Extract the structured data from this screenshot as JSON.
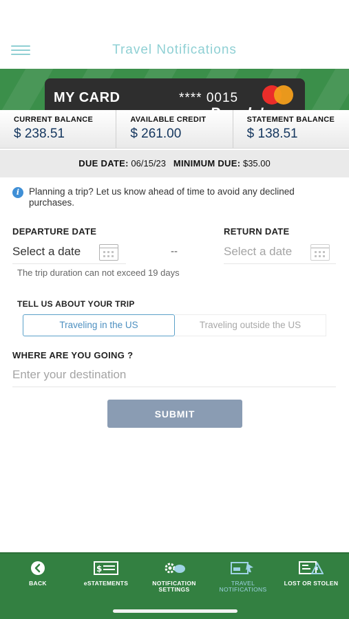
{
  "header": {
    "title": "Travel Notifications",
    "menu_icon": "hamburger-menu-icon"
  },
  "card": {
    "name": "MY CARD",
    "number": "**** 0015",
    "brand_text": "People's",
    "network": "mastercard-logo"
  },
  "balances": [
    {
      "label": "CURRENT BALANCE",
      "value": "$ 238.51"
    },
    {
      "label": "AVAILABLE CREDIT",
      "value": "$ 261.00"
    },
    {
      "label": "STATEMENT BALANCE",
      "value": "$ 138.51"
    }
  ],
  "due": {
    "due_label": "DUE DATE:",
    "due_value": "06/15/23",
    "min_label": "MINIMUM DUE:",
    "min_value": "$35.00"
  },
  "info": {
    "text": "Planning a trip? Let us know ahead of time to avoid any declined purchases."
  },
  "dates": {
    "departure_label": "DEPARTURE DATE",
    "departure_placeholder": "Select a date",
    "return_label": "RETURN DATE",
    "return_placeholder": "Select a date",
    "separator": "--",
    "hint": "The trip duration can not exceed 19 days"
  },
  "trip": {
    "label": "TELL US ABOUT YOUR TRIP",
    "options": [
      "Traveling in the US",
      "Traveling outside the US"
    ],
    "selected": "Traveling in the US"
  },
  "destination": {
    "label": "WHERE ARE YOU GOING ?",
    "placeholder": "Enter your destination",
    "value": ""
  },
  "submit_label": "SUBMIT",
  "tabbar": {
    "items": [
      {
        "label": "BACK",
        "icon": "back-arrow-icon"
      },
      {
        "label": "eSTATEMENTS",
        "icon": "statement-icon"
      },
      {
        "label": "NOTIFICATION SETTINGS",
        "icon": "notification-settings-icon"
      },
      {
        "label": "TRAVEL NOTIFICATIONS",
        "icon": "travel-notifications-icon"
      },
      {
        "label": "LOST OR STOLEN",
        "icon": "lost-stolen-icon"
      }
    ],
    "active": "TRAVEL NOTIFICATIONS"
  },
  "colors": {
    "brand_green": "#338041",
    "header_title": "#8fd0d4",
    "balance_value": "#14365e",
    "submit_bg": "#8a9cb3",
    "segment_active": "#4c8fc0"
  }
}
